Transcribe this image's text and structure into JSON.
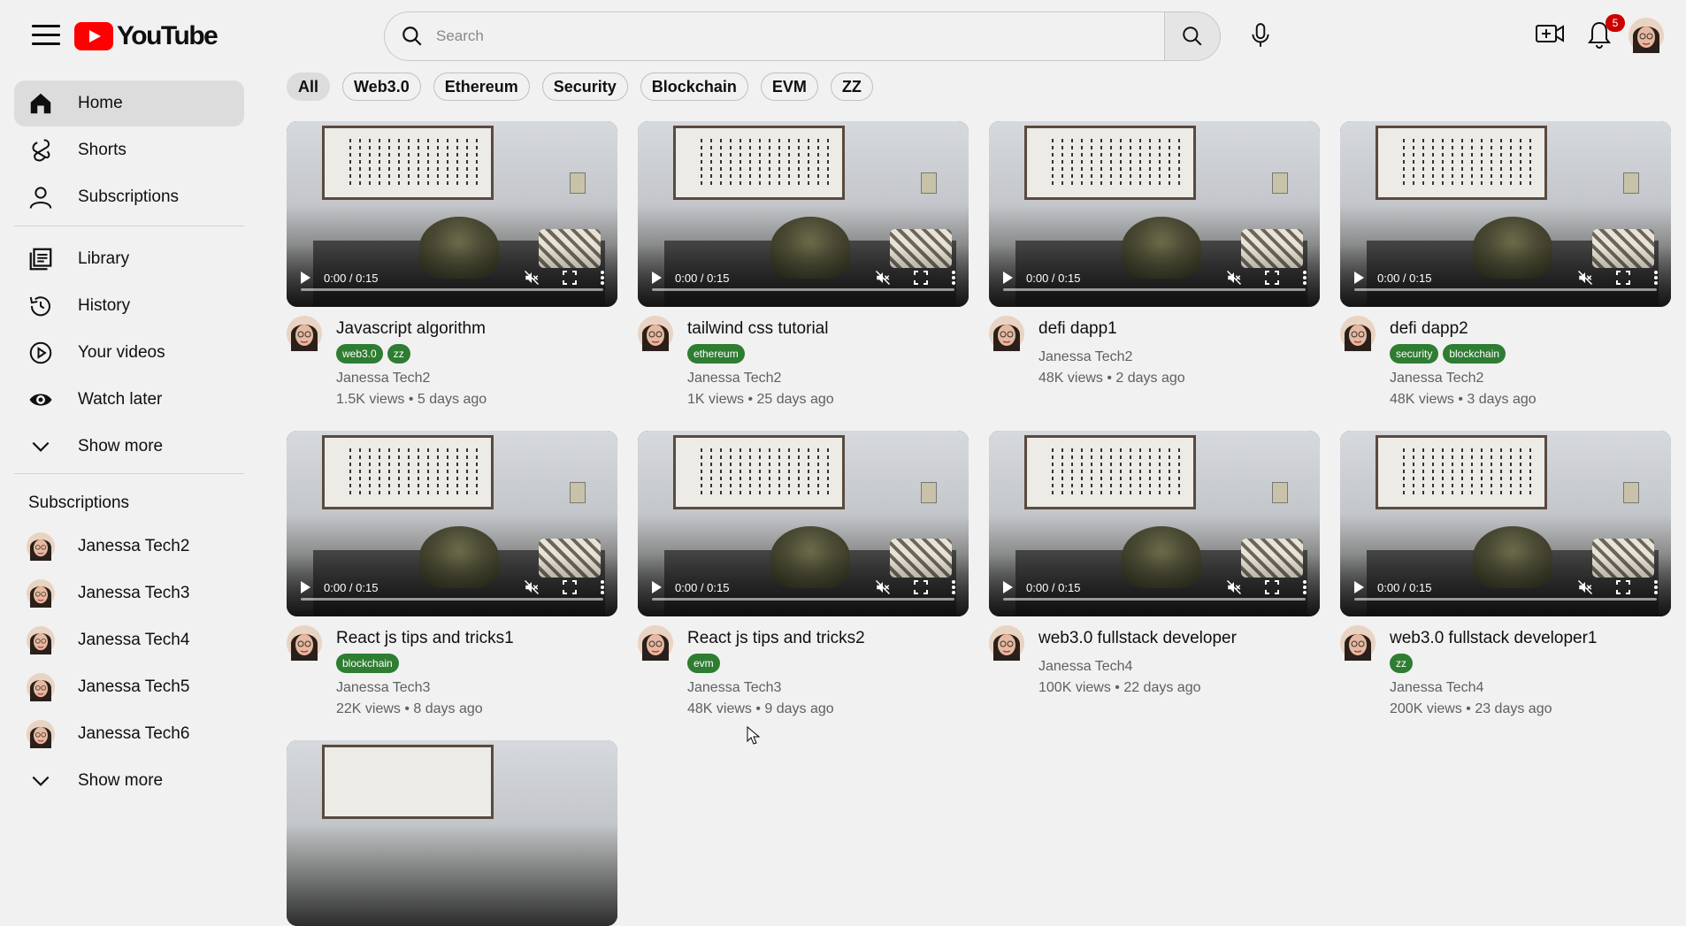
{
  "header": {
    "logo_text": "YouTube",
    "search_placeholder": "Search",
    "notification_count": "5"
  },
  "sidebar": {
    "main": [
      {
        "label": "Home",
        "icon": "home-icon",
        "active": true
      },
      {
        "label": "Shorts",
        "icon": "shorts-icon"
      },
      {
        "label": "Subscriptions",
        "icon": "subscriptions-icon"
      }
    ],
    "library": [
      {
        "label": "Library",
        "icon": "library-icon"
      },
      {
        "label": "History",
        "icon": "history-icon"
      },
      {
        "label": "Your videos",
        "icon": "your-videos-icon"
      },
      {
        "label": "Watch later",
        "icon": "watch-later-icon"
      },
      {
        "label": "Show more",
        "icon": "chevron-down-icon"
      }
    ],
    "subscriptions_title": "Subscriptions",
    "subscriptions": [
      {
        "label": "Janessa Tech2"
      },
      {
        "label": "Janessa Tech3"
      },
      {
        "label": "Janessa Tech4"
      },
      {
        "label": "Janessa Tech5"
      },
      {
        "label": "Janessa Tech6"
      }
    ],
    "subscriptions_more": "Show more"
  },
  "chips": [
    "All",
    "Web3.0",
    "Ethereum",
    "Security",
    "Blockchain",
    "EVM",
    "ZZ"
  ],
  "player": {
    "time": "0:00 / 0:15"
  },
  "videos": [
    {
      "title": "Javascript algorithm",
      "tags": [
        "web3.0",
        "zz"
      ],
      "channel": "Janessa Tech2",
      "meta": "1.5K views • 5 days ago"
    },
    {
      "title": "tailwind css tutorial",
      "tags": [
        "ethereum"
      ],
      "channel": "Janessa Tech2",
      "meta": "1K views • 25 days ago"
    },
    {
      "title": "defi dapp1",
      "tags": [],
      "channel": "Janessa Tech2",
      "meta": "48K views • 2 days ago"
    },
    {
      "title": "defi dapp2",
      "tags": [
        "security",
        "blockchain"
      ],
      "channel": "Janessa Tech2",
      "meta": "48K views • 3 days ago"
    },
    {
      "title": "React js tips and tricks1",
      "tags": [
        "blockchain"
      ],
      "channel": "Janessa Tech3",
      "meta": "22K views • 8 days ago"
    },
    {
      "title": "React js tips and tricks2",
      "tags": [
        "evm"
      ],
      "channel": "Janessa Tech3",
      "meta": "48K views • 9 days ago"
    },
    {
      "title": "web3.0 fullstack developer",
      "tags": [],
      "channel": "Janessa Tech4",
      "meta": "100K views • 22 days ago"
    },
    {
      "title": "web3.0 fullstack developer1",
      "tags": [
        "zz"
      ],
      "channel": "Janessa Tech4",
      "meta": "200K views • 23 days ago"
    }
  ],
  "colors": {
    "brand_red": "#ff0000",
    "tag_green": "#2e7d32",
    "badge_red": "#cc0000"
  }
}
